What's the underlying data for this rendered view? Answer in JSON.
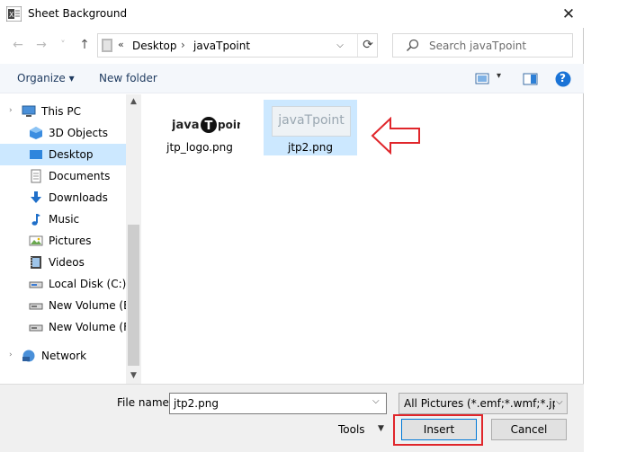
{
  "window": {
    "title": "Sheet Background",
    "close_glyph": "✕",
    "app_icon": "excel-icon"
  },
  "navigation": {
    "back_glyph": "←",
    "forward_glyph": "→",
    "recent_glyph": "˅",
    "up_glyph": "↑",
    "address": {
      "overflow_glyph": "«",
      "parts": [
        "Desktop",
        "javaTpoint"
      ],
      "separator": "›",
      "dropdown_glyph": "⌵",
      "refresh_glyph": "⟳"
    },
    "search": {
      "placeholder": "Search javaTpoint"
    }
  },
  "toolbar": {
    "organize_label": "Organize ▾",
    "new_folder_label": "New folder",
    "view_dropdown_glyph": "▾",
    "help_glyph": "?"
  },
  "sidebar": {
    "items": [
      {
        "label": "This PC",
        "icon": "computer-icon"
      },
      {
        "label": "3D Objects",
        "icon": "3d-objects-icon"
      },
      {
        "label": "Desktop",
        "icon": "desktop-icon",
        "selected": true
      },
      {
        "label": "Documents",
        "icon": "documents-icon"
      },
      {
        "label": "Downloads",
        "icon": "downloads-icon"
      },
      {
        "label": "Music",
        "icon": "music-icon"
      },
      {
        "label": "Pictures",
        "icon": "pictures-icon"
      },
      {
        "label": "Videos",
        "icon": "videos-icon"
      },
      {
        "label": "Local Disk (C:)",
        "icon": "drive-icon"
      },
      {
        "label": "New Volume (E:)",
        "icon": "drive-icon"
      },
      {
        "label": "New Volume (F:)",
        "icon": "drive-icon"
      },
      {
        "label": "Network",
        "icon": "network-icon"
      }
    ],
    "expand_glyph": "›",
    "scroll_up_glyph": "▲",
    "scroll_down_glyph": "▼"
  },
  "files": [
    {
      "name": "jtp_logo.png",
      "thumbnail_text_a": "java",
      "thumbnail_text_b": "T",
      "thumbnail_text_c": "point"
    },
    {
      "name": "jtp2.png",
      "thumbnail_text": "javaTpoint",
      "selected": true
    }
  ],
  "bottom": {
    "file_name_label": "File name:",
    "file_name_value": "jtp2.png",
    "filter_value": "All Pictures (*.emf;*.wmf;*.jpg;*",
    "tools_label": "Tools",
    "insert_label": "Insert",
    "cancel_label": "Cancel",
    "dropdown_glyph": "⌵",
    "tools_dropdown_glyph": "▼"
  },
  "colors": {
    "selection": "#cce8ff",
    "annotation_red": "#e0262b",
    "accent_blue": "#0078d7"
  }
}
